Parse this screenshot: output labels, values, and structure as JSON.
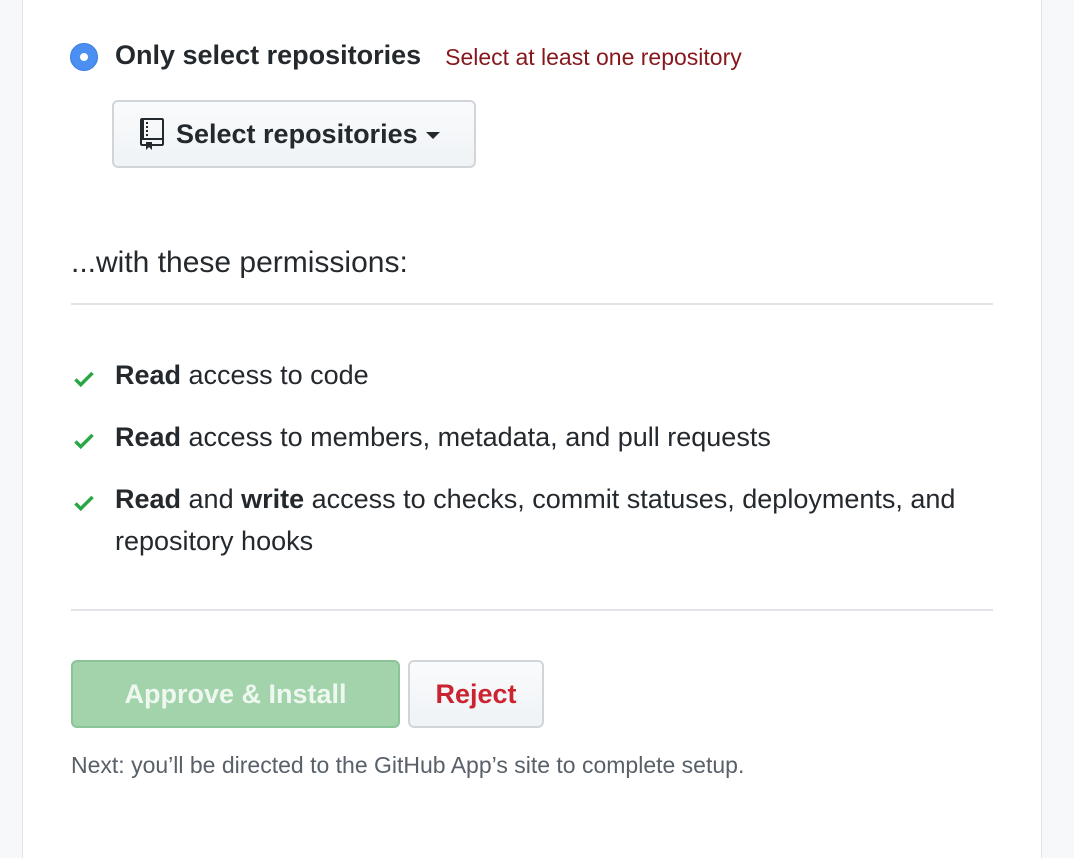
{
  "repository_access": {
    "option_label": "Only select repositories",
    "selected": true,
    "error_message": "Select at least one repository",
    "select_button_label": "Select repositories",
    "select_button_icon": "repo-icon"
  },
  "permissions": {
    "heading": "...with these permissions:",
    "items": [
      {
        "parts": [
          {
            "text": "Read",
            "bold": true
          },
          {
            "text": " access to code",
            "bold": false
          }
        ]
      },
      {
        "parts": [
          {
            "text": "Read",
            "bold": true
          },
          {
            "text": " access to members, metadata, and pull requests",
            "bold": false
          }
        ]
      },
      {
        "parts": [
          {
            "text": "Read",
            "bold": true
          },
          {
            "text": " and ",
            "bold": false
          },
          {
            "text": "write",
            "bold": true
          },
          {
            "text": " access to checks, commit statuses, deployments, and repository hooks",
            "bold": false
          }
        ]
      }
    ],
    "check_icon": "check-icon",
    "check_color": "#28a745"
  },
  "actions": {
    "approve_label": "Approve & Install",
    "approve_disabled": true,
    "reject_label": "Reject",
    "note": "Next: you’ll be directed to the GitHub App’s site to complete setup."
  },
  "colors": {
    "radio_accent": "#4a8ff1",
    "error_text": "#86181d",
    "approve_bg": "#a2d3aa",
    "reject_text": "#cb2431"
  }
}
